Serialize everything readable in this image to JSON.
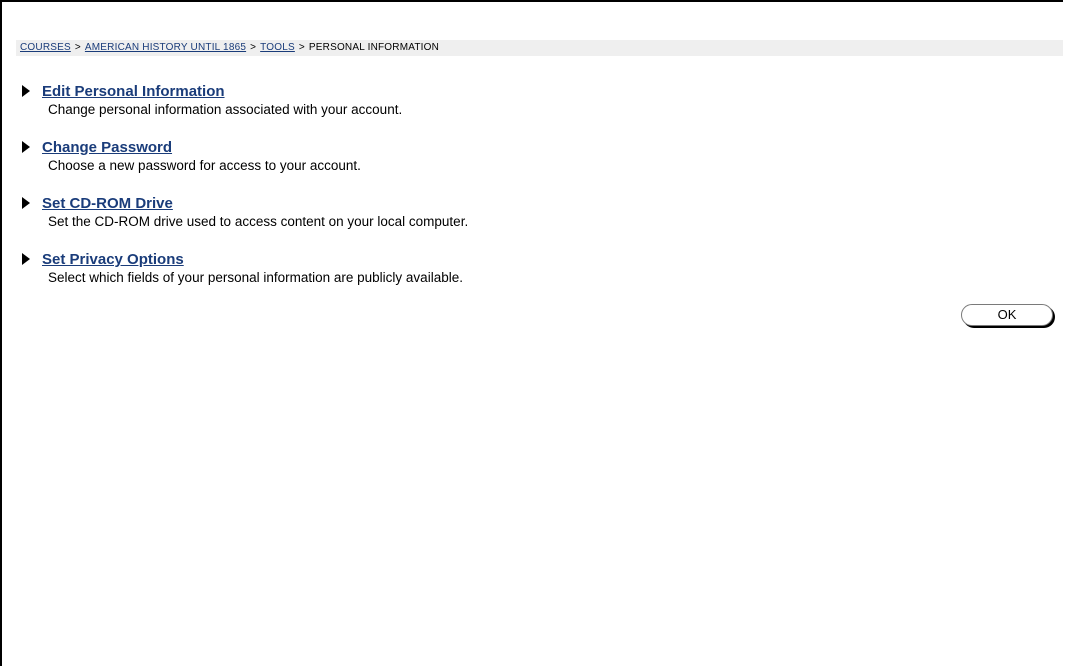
{
  "breadcrumb": {
    "items": [
      {
        "label": "COURSES",
        "link": true
      },
      {
        "label": "AMERICAN HISTORY UNTIL 1865",
        "link": true
      },
      {
        "label": "TOOLS",
        "link": true
      },
      {
        "label": "PERSONAL INFORMATION",
        "link": false
      }
    ],
    "separator": ">"
  },
  "options": [
    {
      "title": "Edit Personal Information",
      "description": "Change personal information associated with your account."
    },
    {
      "title": "Change Password",
      "description": "Choose a new password for access to your account."
    },
    {
      "title": "Set CD-ROM Drive",
      "description": "Set the CD-ROM drive used to access content on your local computer."
    },
    {
      "title": "Set Privacy Options",
      "description": "Select which fields of your personal information are publicly available."
    }
  ],
  "ok_button": {
    "label": "OK"
  },
  "colors": {
    "link": "#1a3c7a",
    "breadcrumb_bg": "#efefef",
    "text": "#000000"
  },
  "icons": {
    "option_bullet": "triangle-right-icon"
  }
}
